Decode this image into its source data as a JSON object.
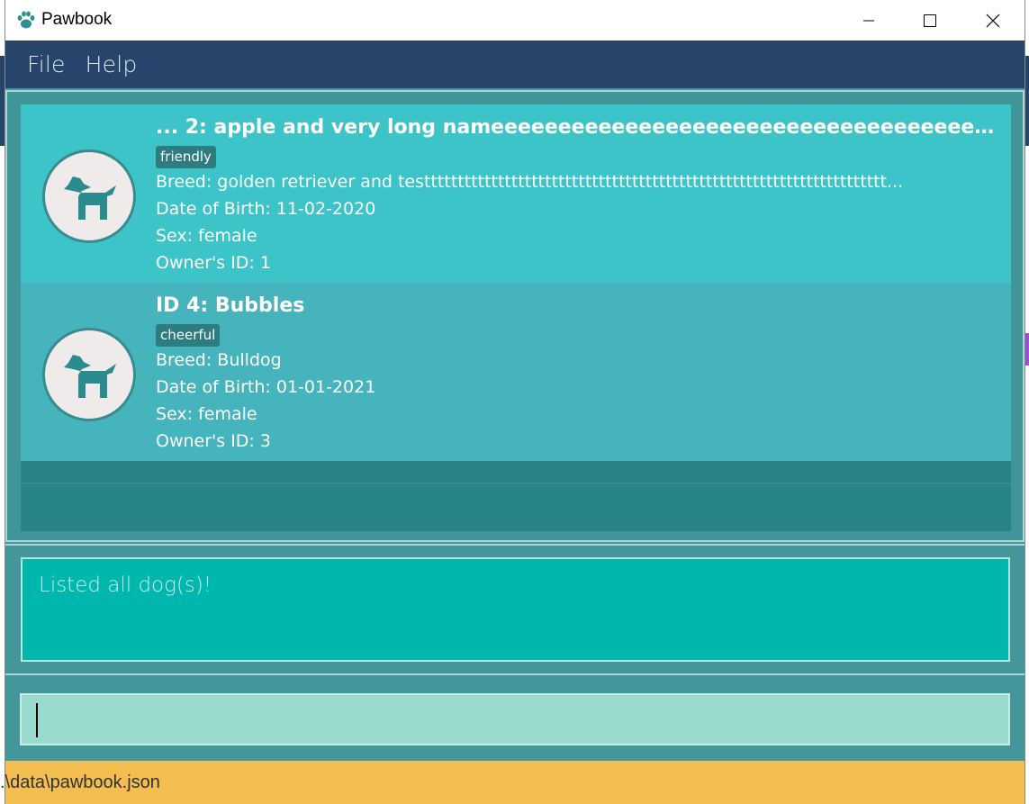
{
  "window": {
    "title": "Pawbook"
  },
  "menu": {
    "items": [
      "File",
      "Help"
    ]
  },
  "dogs": [
    {
      "title": "... 2:  apple and very long nameeeeeeeeeeeeeeeeeeeeeeeeeeeeeeeeeeeeeeeeeeee...",
      "tag": "friendly",
      "breed": "Breed: golden retriever and testtttttttttttttttttttttttttttttttttttttttttttttttttttttttttttttttttttt...",
      "dob": "Date of Birth: 11-02-2020",
      "sex": "Sex: female",
      "owner": "Owner's ID: 1"
    },
    {
      "title": "ID 4:  Bubbles",
      "tag": "cheerful",
      "breed": "Breed: Bulldog",
      "dob": "Date of Birth: 01-01-2021",
      "sex": "Sex: female",
      "owner": "Owner's ID: 3"
    }
  ],
  "result": {
    "message": "Listed all dog(s)!"
  },
  "command": {
    "value": ""
  },
  "status": {
    "path": ".\\data\\pawbook.json"
  },
  "colors": {
    "menubar": "#27456a",
    "card_primary": "#3cc4c9",
    "card_secondary": "#45b4bc",
    "result_box": "#00b7ae",
    "command_box": "#9adbd0",
    "statusbar": "#f3bd50"
  },
  "icons": {
    "app": "paw-icon",
    "avatar": "dog-icon"
  }
}
